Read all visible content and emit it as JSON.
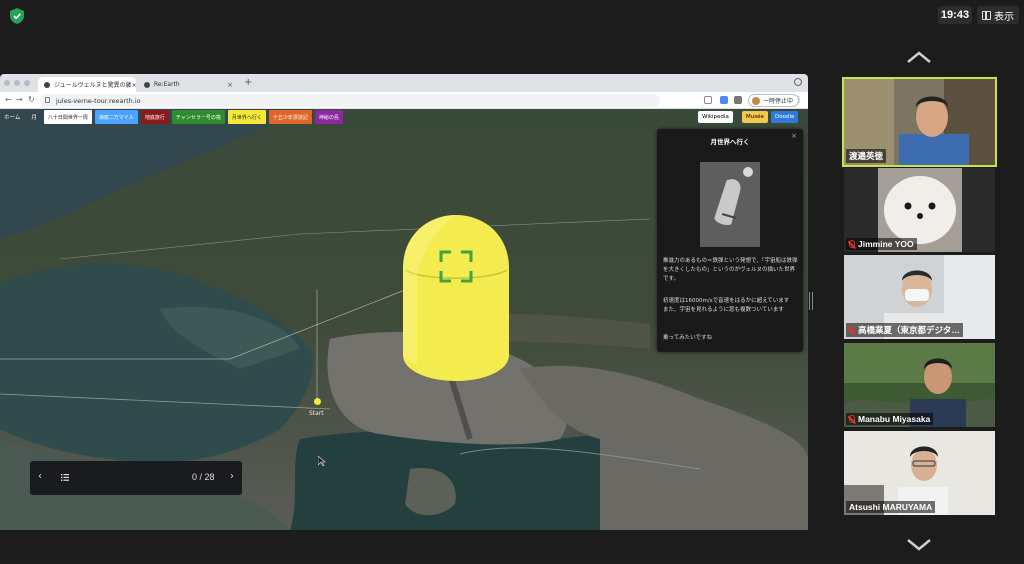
{
  "zoom": {
    "clock": "19:43",
    "view_label": "表示"
  },
  "browser": {
    "tabs": [
      {
        "label": "ジュールヴェルヌと驚異の旅×"
      },
      {
        "label": "Re:Earth"
      }
    ],
    "url": "jules-verne-tour.reearth.io",
    "paused_label": "一時停止中"
  },
  "menu": {
    "home": "ホーム",
    "moon": "月",
    "chips": [
      {
        "label": "八十日間世界一周",
        "color": "#ffffff",
        "text": "#222"
      },
      {
        "label": "海底二万マイル",
        "color": "#4aa3ff",
        "text": "#fff"
      },
      {
        "label": "地底旅行",
        "color": "#8b1b1b",
        "text": "#fff"
      },
      {
        "label": "チャンセラー号の筏",
        "color": "#2e8b2e",
        "text": "#fff"
      },
      {
        "label": "月世界へ行く",
        "color": "#f5e839",
        "text": "#222"
      },
      {
        "label": "十五少年漂流記",
        "color": "#e0672a",
        "text": "#fff"
      },
      {
        "label": "神秘の島",
        "color": "#8a2a9e",
        "text": "#fff"
      }
    ],
    "tools": [
      {
        "label": "Wikipedia",
        "bg": "#ffffff",
        "fg": "#222"
      },
      {
        "label": "Musée",
        "bg": "#f2c94c",
        "fg": "#222"
      },
      {
        "label": "Doodle",
        "bg": "#2f7ad8",
        "fg": "#fff"
      }
    ]
  },
  "map": {
    "start_label": "Start"
  },
  "info_panel": {
    "title": "月世界へ行く",
    "close": "×",
    "paragraphs": [
      "推進力のあるもの＝鉄弾という発想で、「宇宙船は鉄弾を大きくしたもの」というのがヴェルヌの描いた世界です。",
      "初速度は16000m/sで音速をはるかに超えています\nまた、宇宙を見れるように窓も複数ついています",
      "乗ってみたいですね"
    ]
  },
  "pager": {
    "count": "0 / 28",
    "prev": "‹",
    "next": "›"
  },
  "participants": [
    {
      "name": "渡邉英徳",
      "muted": false,
      "speaking": true
    },
    {
      "name": "Jimmine YOO",
      "muted": true,
      "speaking": false
    },
    {
      "name": "高橋業夏（東京都デジタ…",
      "muted": true,
      "speaking": false
    },
    {
      "name": "Manabu Miyasaka",
      "muted": true,
      "speaking": false
    },
    {
      "name": "Atsushi MARUYAMA",
      "muted": false,
      "speaking": false
    }
  ]
}
